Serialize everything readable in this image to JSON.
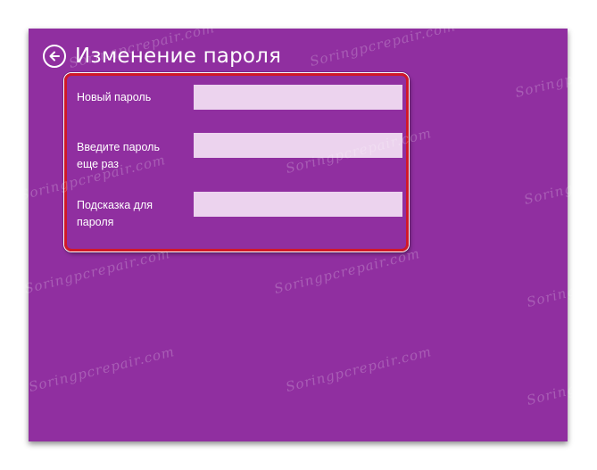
{
  "window": {
    "title": "Изменение пароля",
    "background_color": "#902fa0",
    "back_icon": "arrow-left-circle-icon"
  },
  "form": {
    "highlight_color": "#d01828",
    "fields": [
      {
        "label": "Новый пароль",
        "value": "",
        "placeholder": ""
      },
      {
        "label": "Введите пароль еще раз",
        "value": "",
        "placeholder": ""
      },
      {
        "label": "Подсказка для пароля",
        "value": "",
        "placeholder": ""
      }
    ]
  },
  "watermark": {
    "text": "Soringpcrepair.com"
  }
}
